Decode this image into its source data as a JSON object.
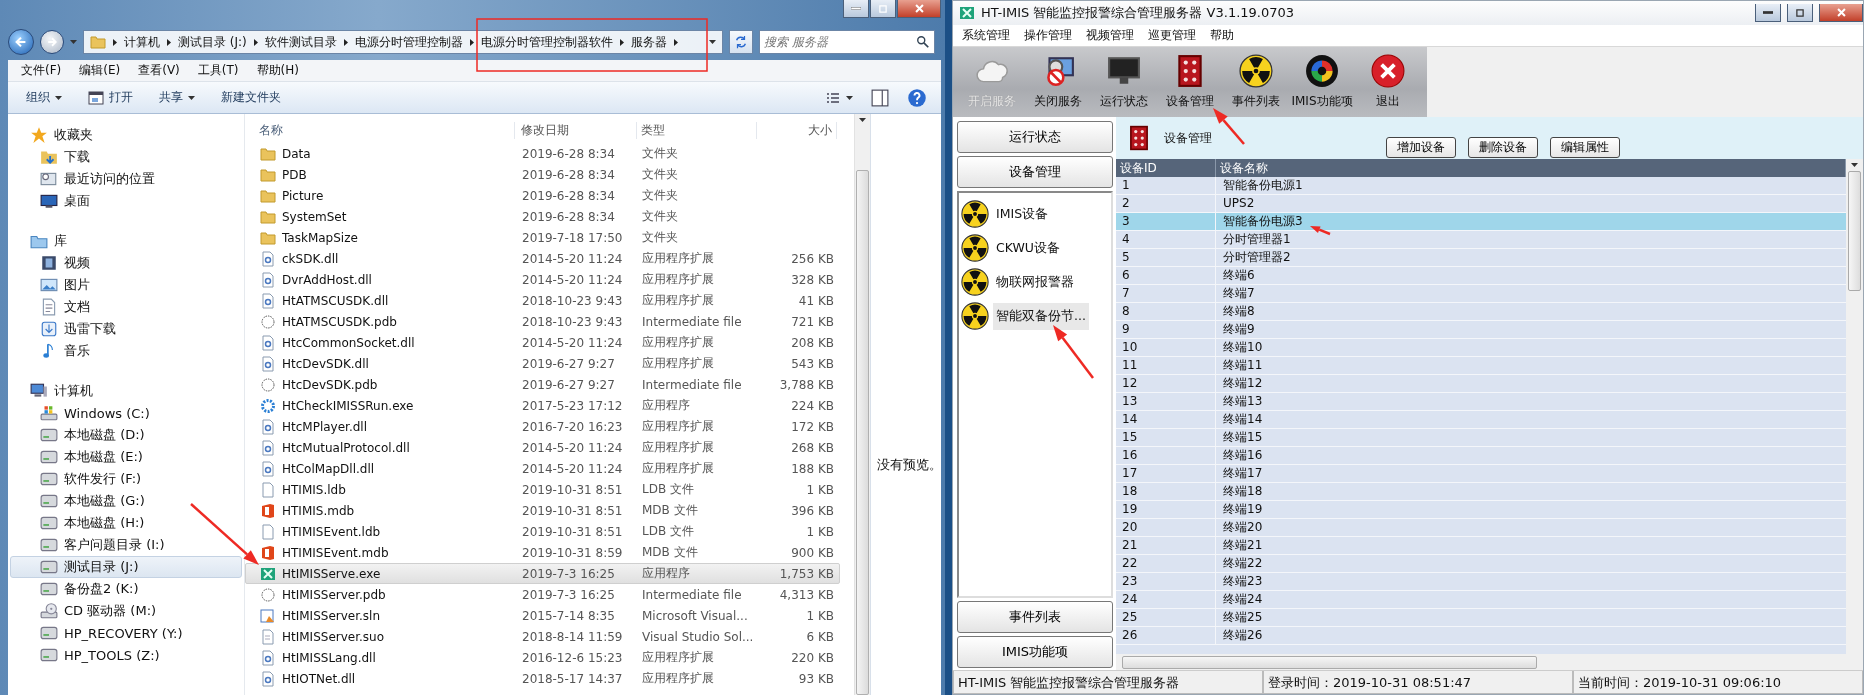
{
  "explorer": {
    "breadcrumb": [
      "计算机",
      "测试目录 (J:)",
      "软件测试目录",
      "电源分时管理控制器",
      "电源分时管理控制器软件",
      "服务器"
    ],
    "search": {
      "placeholder": "搜索 服务器"
    },
    "menu": [
      "文件(F)",
      "编辑(E)",
      "查看(V)",
      "工具(T)",
      "帮助(H)"
    ],
    "toolbar": [
      {
        "label": "组织",
        "kind": "dropdown"
      },
      {
        "label": "打开",
        "kind": "icon"
      },
      {
        "label": "共享",
        "kind": "dropdown"
      },
      {
        "label": "新建文件夹",
        "kind": "plain"
      }
    ],
    "nav": [
      {
        "label": "收藏夹",
        "kind": "star",
        "selected": false,
        "children": [
          {
            "label": "下载",
            "kind": "download",
            "selected": false
          },
          {
            "label": "最近访问的位置",
            "kind": "recent",
            "selected": false
          },
          {
            "label": "桌面",
            "kind": "desktop",
            "selected": false
          }
        ]
      },
      {
        "label": "库",
        "kind": "library",
        "selected": false,
        "children": [
          {
            "label": "视频",
            "kind": "video",
            "selected": false
          },
          {
            "label": "图片",
            "kind": "picture",
            "selected": false
          },
          {
            "label": "文档",
            "kind": "document",
            "selected": false
          },
          {
            "label": "迅雷下载",
            "kind": "download2",
            "selected": false
          },
          {
            "label": "音乐",
            "kind": "music",
            "selected": false
          }
        ]
      },
      {
        "label": "计算机",
        "kind": "computer",
        "selected": false,
        "children": [
          {
            "label": "Windows (C:)",
            "kind": "windows",
            "selected": false
          },
          {
            "label": "本地磁盘 (D:)",
            "kind": "drive",
            "selected": false
          },
          {
            "label": "本地磁盘 (E:)",
            "kind": "drive",
            "selected": false
          },
          {
            "label": "软件发行 (F:)",
            "kind": "drive",
            "selected": false
          },
          {
            "label": "本地磁盘 (G:)",
            "kind": "drive",
            "selected": false
          },
          {
            "label": "本地磁盘 (H:)",
            "kind": "drive",
            "selected": false
          },
          {
            "label": "客户问题目录 (I:)",
            "kind": "drive",
            "selected": false
          },
          {
            "label": "测试目录 (J:)",
            "kind": "drive",
            "selected": true
          },
          {
            "label": "备份盘2 (K:)",
            "kind": "drive",
            "selected": false
          },
          {
            "label": "CD 驱动器 (M:)",
            "kind": "cd",
            "selected": false
          },
          {
            "label": "HP_RECOVERY (Y:)",
            "kind": "drive",
            "selected": false
          },
          {
            "label": "HP_TOOLS (Z:)",
            "kind": "drive",
            "selected": false
          }
        ]
      }
    ],
    "columns": [
      "名称",
      "修改日期",
      "类型",
      "大小"
    ],
    "files": [
      {
        "name": "Data",
        "date": "2019-6-28 8:34",
        "type": "文件夹",
        "kind": "folder",
        "selected": false
      },
      {
        "name": "PDB",
        "date": "2019-6-28 8:34",
        "type": "文件夹",
        "kind": "folder",
        "selected": false
      },
      {
        "name": "Picture",
        "date": "2019-6-28 8:34",
        "type": "文件夹",
        "kind": "folder",
        "selected": false
      },
      {
        "name": "SystemSet",
        "date": "2019-6-28 8:34",
        "type": "文件夹",
        "kind": "folder",
        "selected": false
      },
      {
        "name": "TaskMapSize",
        "date": "2019-7-18 17:50",
        "type": "文件夹",
        "kind": "folder",
        "selected": false
      },
      {
        "name": "ckSDK.dll",
        "date": "2014-5-20 11:24",
        "type": "应用程序扩展",
        "size": "256 KB",
        "kind": "dll",
        "selected": false
      },
      {
        "name": "DvrAddHost.dll",
        "date": "2014-5-20 11:24",
        "type": "应用程序扩展",
        "size": "328 KB",
        "kind": "dll",
        "selected": false
      },
      {
        "name": "HtATMSCUSDK.dll",
        "date": "2018-10-23 9:43",
        "type": "应用程序扩展",
        "size": "41 KB",
        "kind": "dll",
        "selected": false
      },
      {
        "name": "HtATMSCUSDK.pdb",
        "date": "2018-10-23 9:43",
        "type": "Intermediate file",
        "size": "721 KB",
        "kind": "pdb",
        "selected": false
      },
      {
        "name": "HtcCommonSocket.dll",
        "date": "2014-5-20 11:24",
        "type": "应用程序扩展",
        "size": "208 KB",
        "kind": "dll",
        "selected": false
      },
      {
        "name": "HtcDevSDK.dll",
        "date": "2019-6-27 9:27",
        "type": "应用程序扩展",
        "size": "543 KB",
        "kind": "dll",
        "selected": false
      },
      {
        "name": "HtcDevSDK.pdb",
        "date": "2019-6-27 9:27",
        "type": "Intermediate file",
        "size": "3,788 KB",
        "kind": "pdb",
        "selected": false
      },
      {
        "name": "HtCheckIMISSRun.exe",
        "date": "2017-5-23 17:12",
        "type": "应用程序",
        "size": "224 KB",
        "kind": "exe",
        "selected": false
      },
      {
        "name": "HtcMPlayer.dll",
        "date": "2016-7-20 16:23",
        "type": "应用程序扩展",
        "size": "172 KB",
        "kind": "dll",
        "selected": false
      },
      {
        "name": "HtcMutualProtocol.dll",
        "date": "2014-5-20 11:24",
        "type": "应用程序扩展",
        "size": "268 KB",
        "kind": "dll",
        "selected": false
      },
      {
        "name": "HtColMapDll.dll",
        "date": "2014-5-20 11:24",
        "type": "应用程序扩展",
        "size": "188 KB",
        "kind": "dll",
        "selected": false
      },
      {
        "name": "HTIMIS.ldb",
        "date": "2019-10-31 8:51",
        "type": "LDB 文件",
        "size": "1 KB",
        "kind": "blank",
        "selected": false
      },
      {
        "name": "HTIMIS.mdb",
        "date": "2019-10-31 8:51",
        "type": "MDB 文件",
        "size": "396 KB",
        "kind": "mdb",
        "selected": false
      },
      {
        "name": "HTIMISEvent.ldb",
        "date": "2019-10-31 8:51",
        "type": "LDB 文件",
        "size": "1 KB",
        "kind": "blank",
        "selected": false
      },
      {
        "name": "HTIMISEvent.mdb",
        "date": "2019-10-31 8:59",
        "type": "MDB 文件",
        "size": "900 KB",
        "kind": "mdb",
        "selected": false
      },
      {
        "name": "HtIMISServe.exe",
        "date": "2019-7-3 16:25",
        "type": "应用程序",
        "size": "1,753 KB",
        "kind": "app",
        "selected": true
      },
      {
        "name": "HtIMISServer.pdb",
        "date": "2019-7-3 16:25",
        "type": "Intermediate file",
        "size": "4,313 KB",
        "kind": "pdb",
        "selected": false
      },
      {
        "name": "HtIMISServer.sln",
        "date": "2015-7-14 8:35",
        "type": "Microsoft Visual...",
        "size": "1 KB",
        "kind": "sln",
        "selected": false
      },
      {
        "name": "HtIMISServer.suo",
        "date": "2018-8-14 11:59",
        "type": "Visual Studio Sol...",
        "size": "6 KB",
        "kind": "suo",
        "selected": false
      },
      {
        "name": "HtIMISSLang.dll",
        "date": "2016-12-6 15:23",
        "type": "应用程序扩展",
        "size": "220 KB",
        "kind": "dll",
        "selected": false
      },
      {
        "name": "HtIOTNet.dll",
        "date": "2018-5-17 14:37",
        "type": "应用程序扩展",
        "size": "93 KB",
        "kind": "dll",
        "selected": false
      }
    ],
    "preview": "没有预览。"
  },
  "app": {
    "title": "HT-IMIS 智能监控报警综合管理服务器 V3.1.19.0703",
    "menu": [
      "系统管理",
      "操作管理",
      "视频管理",
      "巡更管理",
      "帮助"
    ],
    "toolbar": [
      {
        "label": "开启服务",
        "kind": "cloud",
        "disabled": true
      },
      {
        "label": "关闭服务",
        "kind": "stop",
        "disabled": false
      },
      {
        "label": "运行状态",
        "kind": "monitor",
        "disabled": false
      },
      {
        "label": "设备管理",
        "kind": "device",
        "disabled": false
      },
      {
        "label": "事件列表",
        "kind": "radiation",
        "disabled": false
      },
      {
        "label": "IMIS功能项",
        "kind": "wheel",
        "disabled": false
      },
      {
        "label": "退出",
        "kind": "exit",
        "disabled": false
      }
    ],
    "side_top": [
      "运行状态",
      "设备管理"
    ],
    "device_tree": [
      {
        "label": "IMIS设备",
        "selected": false
      },
      {
        "label": "CKWU设备",
        "selected": false
      },
      {
        "label": "物联网报警器",
        "selected": false
      },
      {
        "label": "智能双备份节...",
        "selected": true
      }
    ],
    "side_bottom": [
      "事件列表",
      "IMIS功能项"
    ],
    "panel": {
      "title": "设备管理",
      "buttons": [
        "增加设备",
        "删除设备",
        "编辑属性"
      ]
    },
    "table": {
      "columns": [
        "设备ID",
        "设备名称"
      ],
      "rows": [
        {
          "id": "1",
          "name": "智能备份电源1",
          "selected": false
        },
        {
          "id": "2",
          "name": "UPS2",
          "selected": false
        },
        {
          "id": "3",
          "name": "智能备份电源3",
          "selected": true
        },
        {
          "id": "4",
          "name": "分时管理器1",
          "selected": false
        },
        {
          "id": "5",
          "name": "分时管理器2",
          "selected": false
        },
        {
          "id": "6",
          "name": "终端6",
          "selected": false
        },
        {
          "id": "7",
          "name": "终端7",
          "selected": false
        },
        {
          "id": "8",
          "name": "终端8",
          "selected": false
        },
        {
          "id": "9",
          "name": "终端9",
          "selected": false
        },
        {
          "id": "10",
          "name": "终端10",
          "selected": false
        },
        {
          "id": "11",
          "name": "终端11",
          "selected": false
        },
        {
          "id": "12",
          "name": "终端12",
          "selected": false
        },
        {
          "id": "13",
          "name": "终端13",
          "selected": false
        },
        {
          "id": "14",
          "name": "终端14",
          "selected": false
        },
        {
          "id": "15",
          "name": "终端15",
          "selected": false
        },
        {
          "id": "16",
          "name": "终端16",
          "selected": false
        },
        {
          "id": "17",
          "name": "终端17",
          "selected": false
        },
        {
          "id": "18",
          "name": "终端18",
          "selected": false
        },
        {
          "id": "19",
          "name": "终端19",
          "selected": false
        },
        {
          "id": "20",
          "name": "终端20",
          "selected": false
        },
        {
          "id": "21",
          "name": "终端21",
          "selected": false
        },
        {
          "id": "22",
          "name": "终端22",
          "selected": false
        },
        {
          "id": "23",
          "name": "终端23",
          "selected": false
        },
        {
          "id": "24",
          "name": "终端24",
          "selected": false
        },
        {
          "id": "25",
          "name": "终端25",
          "selected": false
        },
        {
          "id": "26",
          "name": "终端26",
          "selected": false
        }
      ]
    },
    "status_bar": [
      "HT-IMIS 智能监控报警综合管理服务器",
      "登录时间：2019-10-31 08:51:47",
      "当前时间：2019-10-31 09:06:10"
    ]
  }
}
